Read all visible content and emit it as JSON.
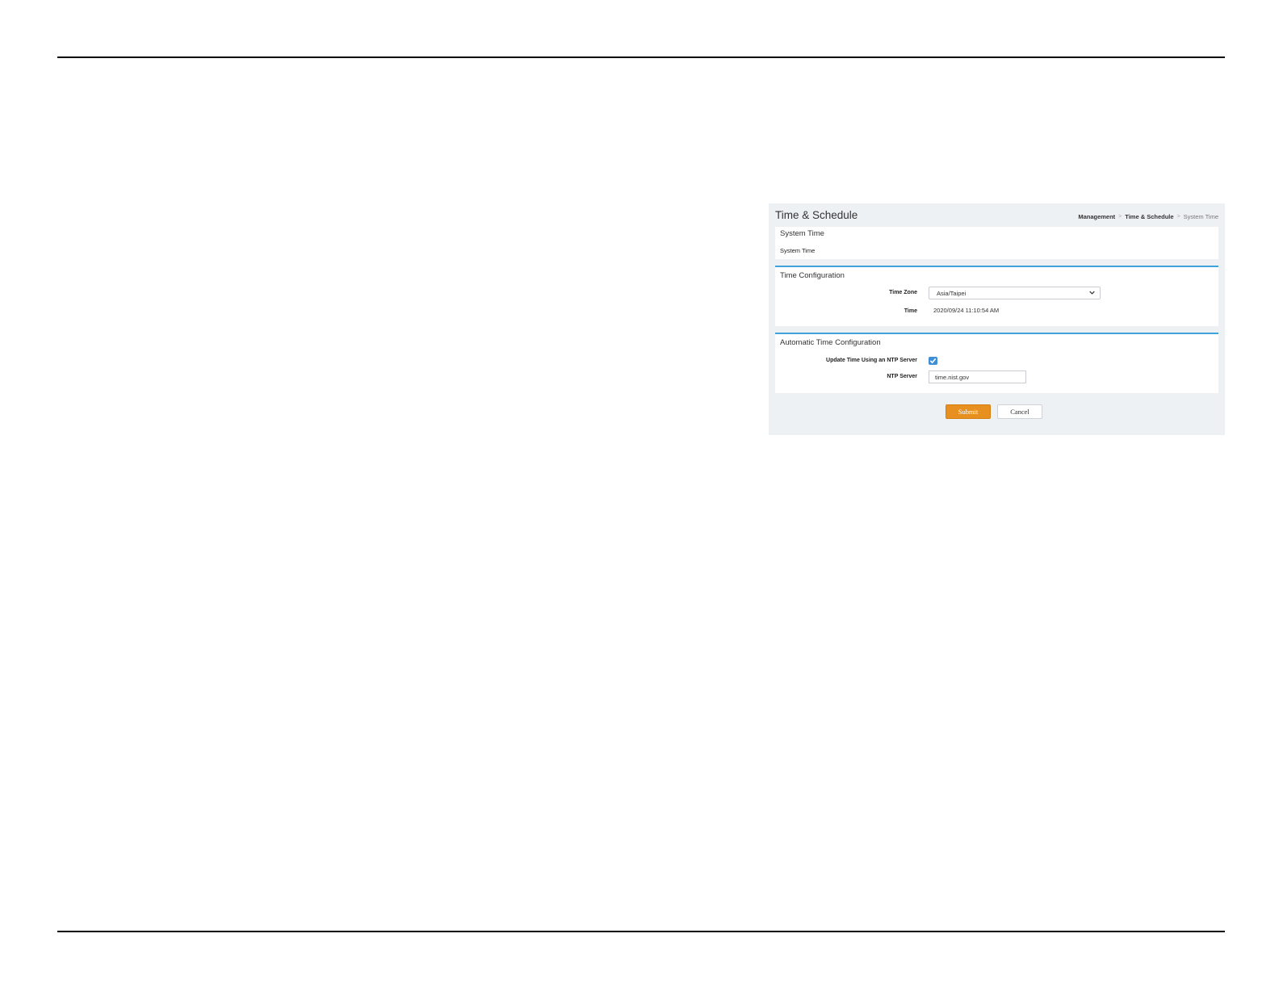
{
  "panel": {
    "title": "Time & Schedule",
    "breadcrumb": [
      "Management",
      "Time & Schedule",
      "System Time"
    ],
    "breadcrumb_separator": ">"
  },
  "system_time": {
    "title": "System Time",
    "subtitle": "System Time"
  },
  "time_configuration": {
    "title": "Time Configuration",
    "time_zone_label": "Time Zone",
    "time_zone_value": "Asia/Taipei",
    "time_label": "Time",
    "time_value": "2020/09/24 11:10:54 AM"
  },
  "automatic_time": {
    "title": "Automatic Time Configuration",
    "ntp_checkbox_label": "Update Time Using an NTP Server",
    "ntp_checkbox_checked": true,
    "ntp_server_label": "NTP Server",
    "ntp_server_value": "time.nist.gov"
  },
  "actions": {
    "submit_label": "Submit",
    "cancel_label": "Cancel"
  },
  "colors": {
    "accent": "#3fa3d9",
    "submit": "#e8901f",
    "checkbox": "#3e8fd6",
    "panel_bg": "#eef1f4"
  }
}
